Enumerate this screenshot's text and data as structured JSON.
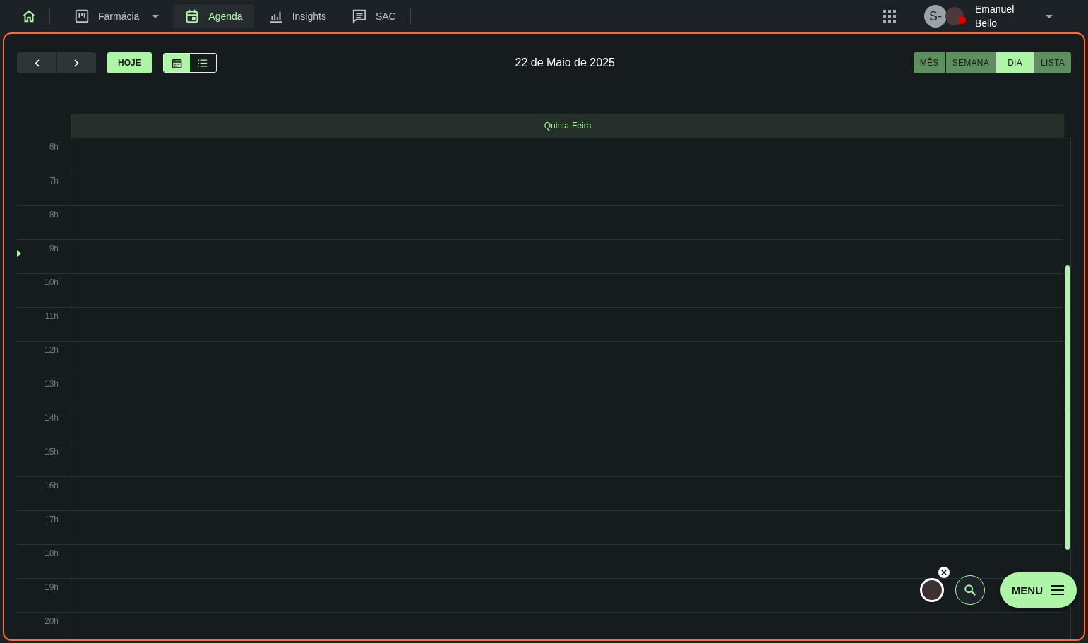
{
  "nav": {
    "items": [
      {
        "kind": "board",
        "label": "Farmácia",
        "dropdown": true,
        "selected": false
      },
      {
        "kind": "calendar",
        "label": "Agenda",
        "dropdown": false,
        "selected": true
      },
      {
        "kind": "chart",
        "label": "Insights",
        "dropdown": false,
        "selected": false
      },
      {
        "kind": "chat",
        "label": "SAC",
        "dropdown": false,
        "selected": false
      }
    ]
  },
  "user": {
    "initials": "S-",
    "first_name": "Emanuel",
    "last_name": "Bello"
  },
  "toolbar": {
    "today": "HOJE",
    "layout": [
      {
        "kind": "calendar",
        "selected": true
      },
      {
        "kind": "list",
        "selected": false
      }
    ],
    "title": "22 de Maio de 2025",
    "views": [
      {
        "label": "MÊS",
        "selected": false
      },
      {
        "label": "SEMANA",
        "selected": false
      },
      {
        "label": "DIA",
        "selected": true
      },
      {
        "label": "LISTA",
        "selected": false
      }
    ]
  },
  "calendar": {
    "day": "Quinta-Feira",
    "hours": [
      "6h",
      "7h",
      "8h",
      "9h",
      "10h",
      "11h",
      "12h",
      "13h",
      "14h",
      "15h",
      "16h",
      "17h",
      "18h",
      "19h",
      "20h"
    ]
  },
  "fab": {
    "menu": "MENU"
  }
}
